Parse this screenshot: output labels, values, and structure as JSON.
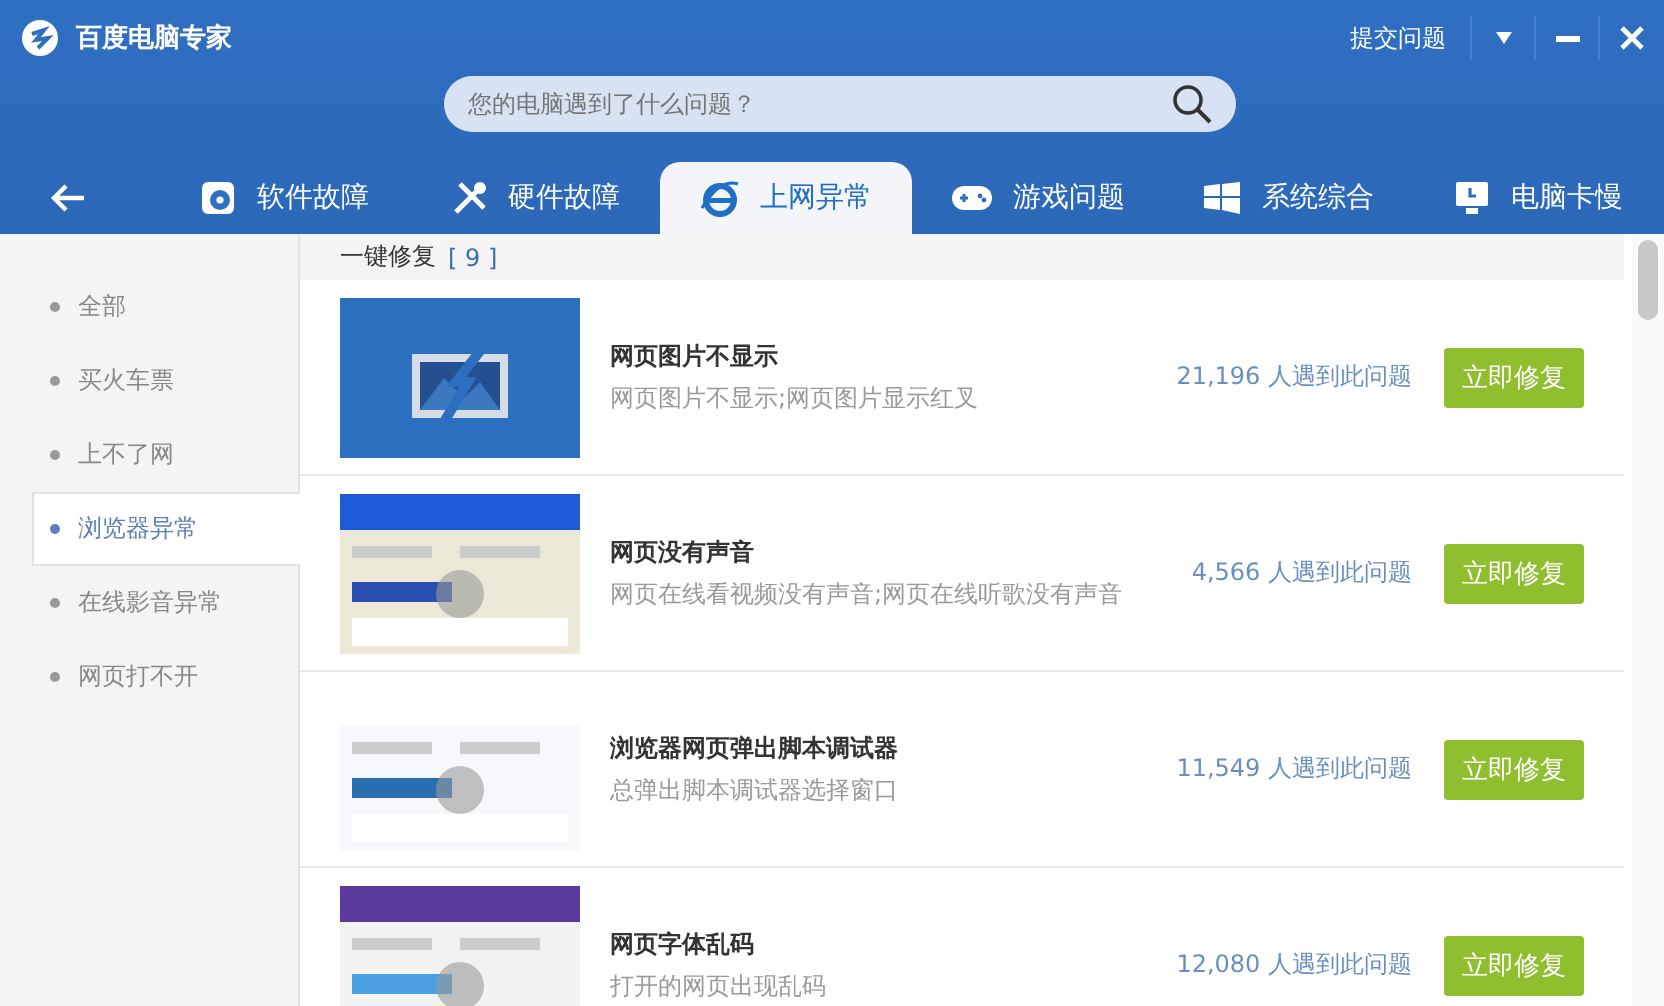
{
  "window": {
    "title": "百度电脑专家",
    "feedback": "提交问题"
  },
  "search": {
    "placeholder": "您的电脑遇到了什么问题？"
  },
  "tabs": [
    {
      "label": "软件故障",
      "selected": false
    },
    {
      "label": "硬件故障",
      "selected": false
    },
    {
      "label": "上网异常",
      "selected": true
    },
    {
      "label": "游戏问题",
      "selected": false
    },
    {
      "label": "系统综合",
      "selected": false
    },
    {
      "label": "电脑卡慢",
      "selected": false
    }
  ],
  "sidebar": {
    "items": [
      {
        "label": "全部",
        "selected": false
      },
      {
        "label": "买火车票",
        "selected": false
      },
      {
        "label": "上不了网",
        "selected": false
      },
      {
        "label": "浏览器异常",
        "selected": true
      },
      {
        "label": "在线影音异常",
        "selected": false
      },
      {
        "label": "网页打不开",
        "selected": false
      }
    ]
  },
  "list": {
    "title": "一键修复",
    "count": "[ 9 ]",
    "items": [
      {
        "title": "网页图片不显示",
        "description": "网页图片不显示;网页图片显示红叉",
        "count": "21,196 人遇到此问题",
        "button": "立即修复"
      },
      {
        "kind": "picture",
        "title": "网页没有声音",
        "description": "网页在线看视频没有声音;网页在线听歌没有声音",
        "count": "4,566 人遇到此问题",
        "button": "立即修复"
      },
      {
        "kind": "picture",
        "title": "浏览器网页弹出脚本调试器",
        "description": "总弹出脚本调试器选择窗口",
        "count": "11,549 人遇到此问题",
        "button": "立即修复"
      },
      {
        "kind": "picture",
        "title": "网页字体乱码",
        "description": "打开的网页出现乱码",
        "count": "12,080 人遇到此问题",
        "button": "立即修复"
      }
    ]
  }
}
